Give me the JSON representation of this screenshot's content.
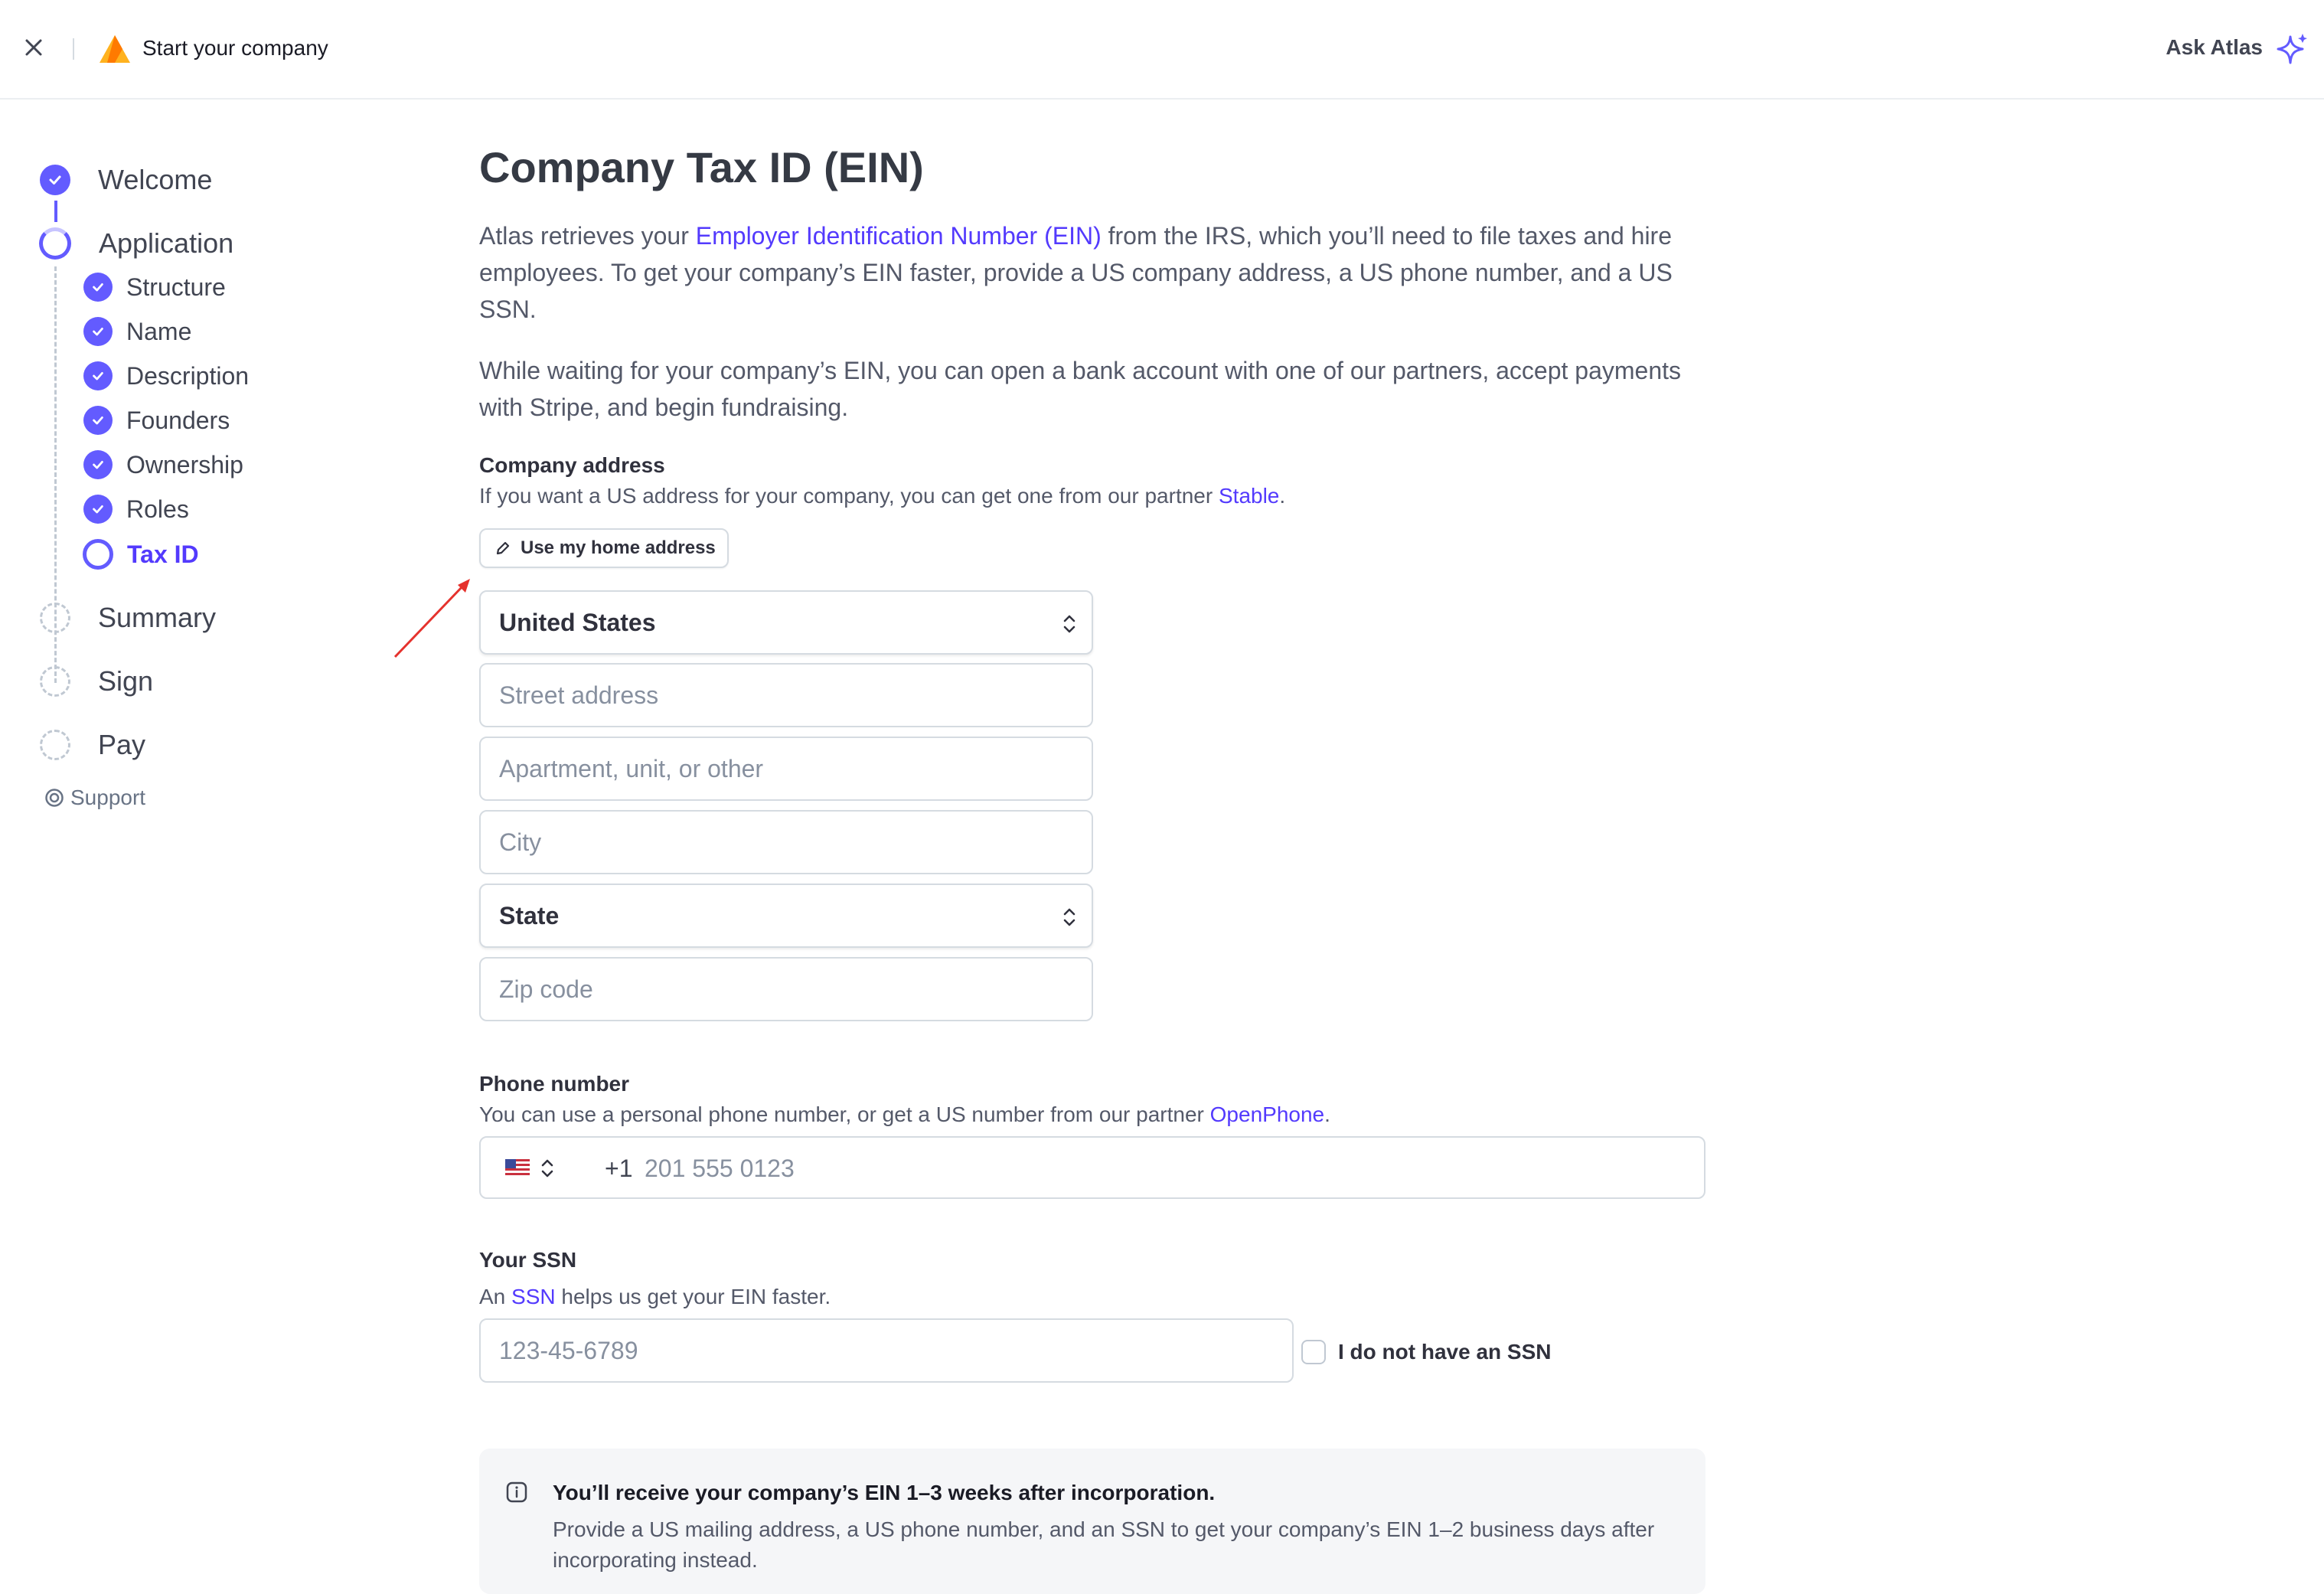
{
  "header": {
    "title": "Start your company",
    "ask_atlas": "Ask Atlas"
  },
  "sidebar": {
    "welcome": "Welcome",
    "application": "Application",
    "substeps": [
      "Structure",
      "Name",
      "Description",
      "Founders",
      "Ownership",
      "Roles",
      "Tax ID"
    ],
    "summary": "Summary",
    "sign": "Sign",
    "pay": "Pay",
    "support": "Support"
  },
  "main": {
    "title": "Company Tax ID (EIN)",
    "intro_before": "Atlas retrieves your ",
    "intro_link": "Employer Identification Number (EIN)",
    "intro_after": " from the IRS, which you’ll need to file taxes and hire employees. To get your company’s EIN faster, provide a US company address, a US phone number, and a US SSN.",
    "waiting": "While waiting for your company’s EIN, you can open a bank account with one of our partners, accept payments with Stripe, and begin fundraising.",
    "address": {
      "title": "Company address",
      "desc_before": "If you want a US address for your company, you can get one from our partner ",
      "desc_link": "Stable",
      "desc_after": ".",
      "home_button": "Use my home address",
      "country": "United States",
      "street_placeholder": "Street address",
      "apt_placeholder": "Apartment, unit, or other",
      "city_placeholder": "City",
      "state": "State",
      "zip_placeholder": "Zip code"
    },
    "phone": {
      "title": "Phone number",
      "desc_before": "You can use a personal phone number, or get a US number from our partner ",
      "desc_link": "OpenPhone",
      "desc_after": ".",
      "dial_code": "+1",
      "placeholder": "201 555 0123"
    },
    "ssn": {
      "title": "Your SSN",
      "desc_before": "An ",
      "desc_link": "SSN",
      "desc_after": " helps us get your EIN faster.",
      "placeholder": "123-45-6789",
      "no_ssn_label": "I do not have an SSN"
    },
    "notice": {
      "title": "You’ll receive your company’s EIN 1–3 weeks after incorporation.",
      "body": "Provide a US mailing address, a US phone number, and an SSN to get your company’s EIN 1–2 business days after incorporating instead."
    }
  },
  "colors": {
    "accent": "#635bff",
    "link": "#533afd",
    "annotation_arrow": "#e5322d"
  }
}
